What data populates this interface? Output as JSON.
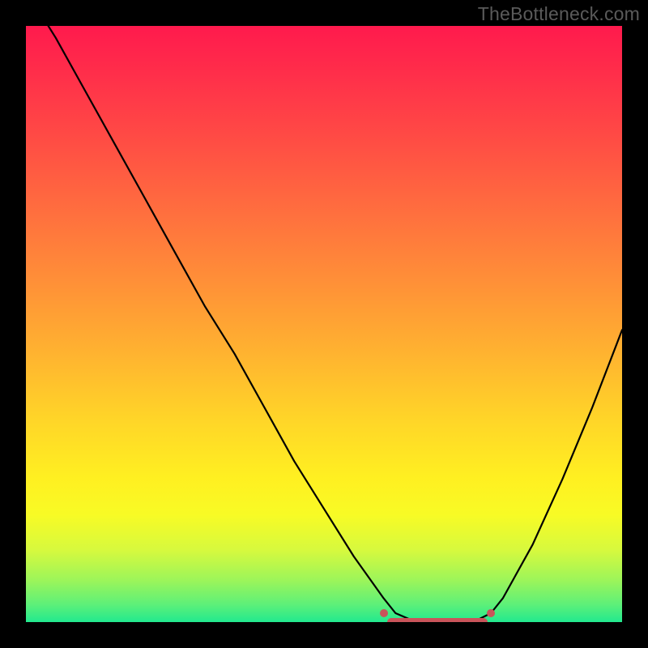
{
  "watermark": "TheBottleneck.com",
  "colors": {
    "page_bg": "#000000",
    "curve": "#000000",
    "marker": "#c9545a",
    "watermark": "#5a5a5a"
  },
  "chart_data": {
    "type": "line",
    "title": "",
    "xlabel": "",
    "ylabel": "",
    "xlim": [
      0,
      100
    ],
    "ylim": [
      0,
      100
    ],
    "grid": false,
    "legend": false,
    "x": [
      0,
      5,
      10,
      15,
      20,
      25,
      30,
      35,
      40,
      45,
      50,
      55,
      60,
      62,
      65,
      70,
      75,
      78,
      80,
      85,
      90,
      95,
      100
    ],
    "values": [
      106,
      98,
      89,
      80,
      71,
      62,
      53,
      45,
      36,
      27,
      19,
      11,
      4,
      1.5,
      0.2,
      0,
      0,
      1.5,
      4,
      13,
      24,
      36,
      49
    ],
    "highlight_region": {
      "x_start": 60,
      "x_end": 78,
      "y": 0
    },
    "notes": "Single V-shaped curve over vertical rainbow gradient; no axis ticks or labels rendered; highlighted minimum region marked in red."
  }
}
